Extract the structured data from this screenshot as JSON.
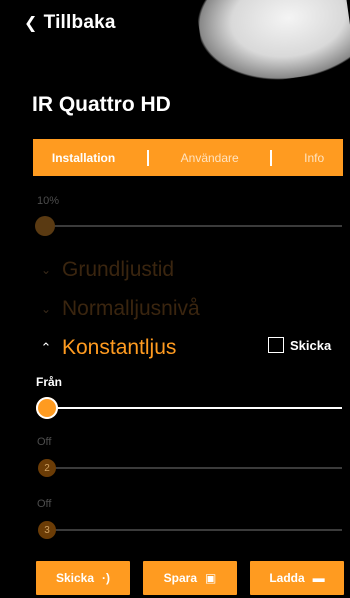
{
  "header": {
    "back_label": "Tillbaka",
    "device_title": "IR Quattro HD"
  },
  "tabs": [
    {
      "label": "Installation",
      "active": true
    },
    {
      "label": "Användare",
      "active": false
    },
    {
      "label": "Info",
      "active": false
    }
  ],
  "sensitivity": {
    "value_label": "10%",
    "level": 0.0
  },
  "sections": {
    "grundljustid": "Grundljustid",
    "normalljusniva": "Normalljusnivå",
    "konstantljus": "Konstantljus"
  },
  "konstantljus_panel": {
    "send_checkbox_label": "Skicka",
    "send_checked": false,
    "channel1_label": "Från",
    "channel2_label": "Off",
    "channel2_number": "2",
    "channel3_label": "Off",
    "channel3_number": "3"
  },
  "footer_buttons": {
    "send": "Skicka",
    "save": "Spara",
    "load": "Ladda"
  },
  "colors": {
    "accent": "#ff9b20",
    "background": "#000000"
  }
}
